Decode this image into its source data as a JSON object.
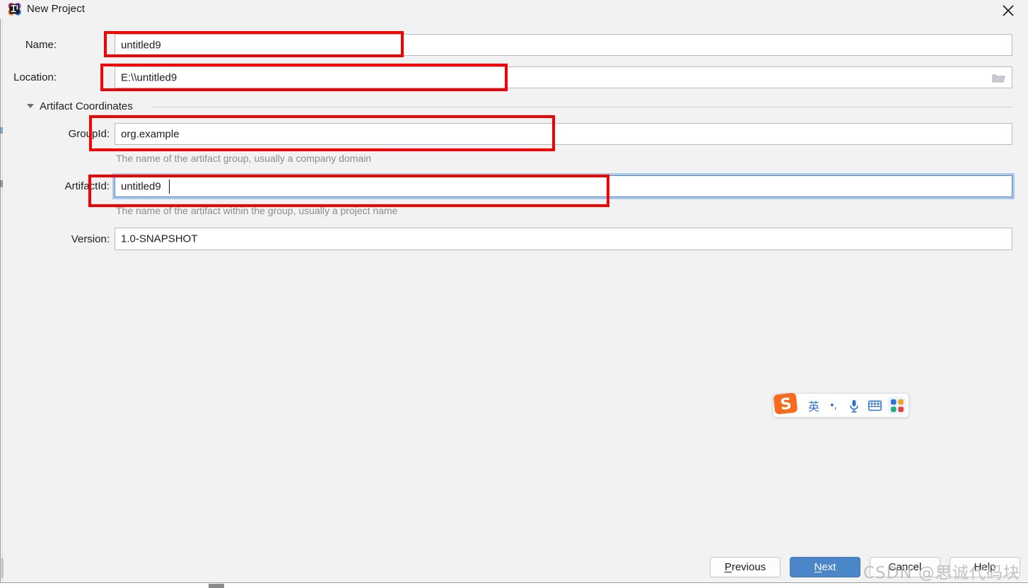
{
  "window": {
    "title": "New Project",
    "app_icon": "intellij-idea-icon",
    "close_label": "✕"
  },
  "form": {
    "name": {
      "label": "Name:",
      "value": "untitled9"
    },
    "location": {
      "label": "Location:",
      "value": "E:\\\\untitled9",
      "browse_icon": "folder-icon"
    },
    "group_section": {
      "title": "Artifact Coordinates",
      "expanded": true,
      "toggle_icon": "chevron-down-icon"
    },
    "group_id": {
      "label": "GroupId:",
      "value": "org.example",
      "hint": "The name of the artifact group, usually a company domain"
    },
    "artifact_id": {
      "label": "ArtifactId:",
      "value": "untitled9",
      "hint": "The name of the artifact within the group, usually a project name",
      "focused": true
    },
    "version": {
      "label": "Version:",
      "value": "1.0-SNAPSHOT"
    }
  },
  "footer": {
    "previous": "Previous",
    "previous_mnemonic": "P",
    "next": "Next",
    "next_mnemonic": "N",
    "cancel": "Cancel",
    "help": "Help"
  },
  "ime": {
    "logo": "sogou-logo-icon",
    "mode": "英",
    "punctuation": "•,",
    "voice_icon": "microphone-icon",
    "keyboard_icon": "keyboard-icon",
    "apps_icon": "app-grid-icon"
  },
  "watermark": {
    "text": "CSDN @思诚代码块"
  },
  "annotations": {
    "color": "#f50000",
    "boxes": [
      {
        "name": "name-field-highlight"
      },
      {
        "name": "location-field-highlight"
      },
      {
        "name": "groupid-field-highlight"
      },
      {
        "name": "artifactid-field-highlight"
      }
    ]
  }
}
